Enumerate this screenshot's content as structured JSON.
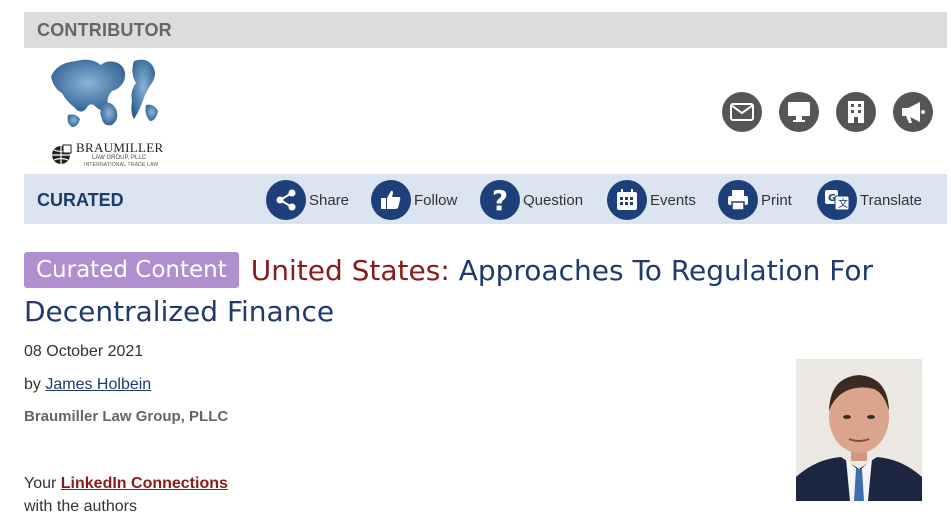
{
  "contributor": {
    "label": "CONTRIBUTOR"
  },
  "logo": {
    "name": "BRAUMILLER",
    "subtitle": "LAW GROUP, PLLC",
    "tagline": "INTERNATIONAL TRADE LAW"
  },
  "contact_icons": [
    {
      "icon": "envelope-icon"
    },
    {
      "icon": "monitor-icon"
    },
    {
      "icon": "building-icon"
    },
    {
      "icon": "megaphone-icon"
    }
  ],
  "curated": {
    "label": "CURATED"
  },
  "actions": {
    "share": "Share",
    "follow": "Follow",
    "question": "Question",
    "events": "Events",
    "print": "Print",
    "translate": "Translate"
  },
  "article": {
    "badge": "Curated Content",
    "country": "United States:",
    "title": "Approaches To Regulation For Decentralized Finance",
    "date": "08 October 2021",
    "by_prefix": "by",
    "author": "James Holbein",
    "firm": "Braumiller Law Group, PLLC"
  },
  "linkedin": {
    "prefix": "Your",
    "link": "LinkedIn Connections",
    "suffix": "with the authors"
  },
  "colors": {
    "navy": "#1d3f7a",
    "badge": "#b08fd0",
    "country": "#8b1a1a"
  }
}
